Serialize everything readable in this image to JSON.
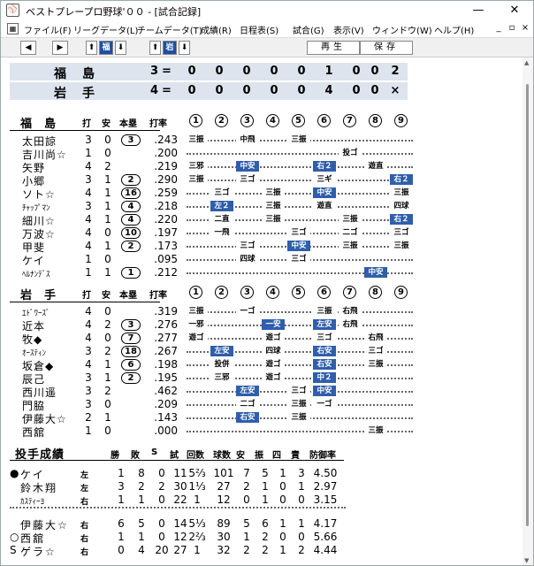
{
  "window": {
    "title": "ベストプレープロ野球'００ - [試合記録]",
    "minimize": "—",
    "maximize": "☐",
    "close": "✕"
  },
  "menu": [
    "ファイル(F)",
    "リーグデータ(L)",
    "チームデータ(T)",
    "成績(R)",
    "日程表(S)",
    "試合(G)",
    "表示(V)",
    "ウィンドウ(W)",
    "ヘルプ(H)"
  ],
  "mdi": [
    "_",
    "▫",
    "×"
  ],
  "toolbar": {
    "prev": "◀",
    "next": "▶",
    "up1": "⬆",
    "team1": "福",
    "down1": "⬇",
    "up2": "⬆",
    "team2": "岩",
    "down2": "⬇",
    "replay": "再生",
    "save": "保存"
  },
  "score": {
    "rows": [
      {
        "team": "福島",
        "total": "3",
        "eq": "=",
        "innings": [
          "0",
          "0",
          "0",
          "0",
          "0",
          "1",
          "0",
          "0",
          "2"
        ]
      },
      {
        "team": "岩手",
        "total": "4",
        "eq": "=",
        "innings": [
          "0",
          "0",
          "0",
          "0",
          "0",
          "4",
          "0",
          "0",
          "×"
        ]
      }
    ]
  },
  "labels": {
    "ab": "打",
    "hit": "安",
    "hr": "本塁",
    "avg": "打率",
    "innings": [
      "1",
      "2",
      "3",
      "4",
      "5",
      "6",
      "7",
      "8",
      "9"
    ]
  },
  "team1": {
    "name": "福島",
    "players": [
      {
        "name": "太田諒",
        "ab": "3",
        "h": "0",
        "hr": "3",
        "avg": ".243",
        "res": [
          [
            "1",
            "三振",
            0
          ],
          [
            "3",
            "中飛",
            0
          ],
          [
            "5",
            "三振",
            0
          ]
        ]
      },
      {
        "name": "吉川尚☆",
        "ab": "1",
        "h": "0",
        "hr": "",
        "avg": ".200",
        "res": [
          [
            "7",
            "投ゴ",
            0
          ]
        ]
      },
      {
        "name": "矢野",
        "ab": "4",
        "h": "2",
        "hr": "",
        "avg": ".219",
        "res": [
          [
            "1",
            "三邪",
            0
          ],
          [
            "3",
            "中安",
            1
          ],
          [
            "6",
            "右２",
            1
          ],
          [
            "8",
            "遊直",
            0
          ]
        ]
      },
      {
        "name": "小郷",
        "ab": "3",
        "h": "1",
        "hr": "2",
        "avg": ".290",
        "res": [
          [
            "1",
            "三振",
            0
          ],
          [
            "3",
            "三ゴ",
            0
          ],
          [
            "6",
            "三ギ",
            0
          ],
          [
            "9",
            "右２",
            1
          ]
        ]
      },
      {
        "name": "ソト☆",
        "ab": "4",
        "h": "1",
        "hr": "16",
        "avg": ".259",
        "res": [
          [
            "2",
            "三ゴ",
            0
          ],
          [
            "4",
            "三振",
            0
          ],
          [
            "6",
            "中安",
            1
          ],
          [
            "9",
            "三振",
            0
          ]
        ]
      },
      {
        "name": "ﾁｬｯﾌﾟﾏﾝ",
        "small": true,
        "ab": "3",
        "h": "1",
        "hr": "4",
        "avg": ".218",
        "res": [
          [
            "2",
            "左２",
            1
          ],
          [
            "4",
            "三振",
            0
          ],
          [
            "6",
            "遊直",
            0
          ],
          [
            "9",
            "四球",
            0
          ]
        ]
      },
      {
        "name": "細川☆",
        "ab": "4",
        "h": "1",
        "hr": "4",
        "avg": ".220",
        "res": [
          [
            "2",
            "二直",
            0
          ],
          [
            "4",
            "三振",
            0
          ],
          [
            "7",
            "三振",
            0
          ],
          [
            "9",
            "右２",
            1
          ]
        ]
      },
      {
        "name": "万波☆",
        "ab": "4",
        "h": "0",
        "hr": "10",
        "avg": ".197",
        "res": [
          [
            "2",
            "一飛",
            0
          ],
          [
            "5",
            "三ゴ",
            0
          ],
          [
            "7",
            "二ゴ",
            0
          ],
          [
            "9",
            "三ゴ",
            0
          ]
        ]
      },
      {
        "name": "甲斐",
        "ab": "4",
        "h": "1",
        "hr": "2",
        "avg": ".173",
        "res": [
          [
            "3",
            "三ゴ",
            0
          ],
          [
            "5",
            "中安",
            1
          ],
          [
            "7",
            "三振",
            0
          ],
          [
            "9",
            "三振",
            0
          ]
        ]
      },
      {
        "name": "ケイ",
        "ab": "1",
        "h": "0",
        "hr": "",
        "avg": ".095",
        "res": [
          [
            "3",
            "四球",
            0
          ],
          [
            "5",
            "三ゴ",
            0
          ]
        ]
      },
      {
        "name": "ﾍﾙﾅﾝﾃﾞｽ",
        "small": true,
        "ab": "1",
        "h": "1",
        "hr": "1",
        "avg": ".212",
        "res": [
          [
            "8",
            "中安",
            1
          ]
        ]
      }
    ]
  },
  "team2": {
    "name": "岩手",
    "players": [
      {
        "name": "ｴﾄﾞﾜｰｽﾞ",
        "small": true,
        "ab": "4",
        "h": "0",
        "hr": "",
        "avg": ".319",
        "res": [
          [
            "1",
            "三振",
            0
          ],
          [
            "3",
            "一ゴ",
            0
          ],
          [
            "6",
            "三振",
            0
          ],
          [
            "7",
            "右飛",
            0
          ]
        ]
      },
      {
        "name": "近本",
        "ab": "4",
        "h": "2",
        "hr": "3",
        "avg": ".276",
        "res": [
          [
            "1",
            "一邪",
            0
          ],
          [
            "4",
            "一安",
            1
          ],
          [
            "6",
            "左安",
            1
          ],
          [
            "7",
            "右飛",
            0
          ]
        ]
      },
      {
        "name": "牧◆",
        "ab": "4",
        "h": "0",
        "hr": "7",
        "avg": ".277",
        "res": [
          [
            "1",
            "遊ゴ",
            0
          ],
          [
            "4",
            "遊ゴ",
            0
          ],
          [
            "6",
            "三ゴ",
            0
          ],
          [
            "8",
            "右飛",
            0
          ]
        ]
      },
      {
        "name": "ｵｰｽﾃｨﾝ",
        "small": true,
        "ab": "3",
        "h": "2",
        "hr": "18",
        "avg": ".267",
        "res": [
          [
            "2",
            "左安",
            1
          ],
          [
            "4",
            "四球",
            0
          ],
          [
            "6",
            "右安",
            1
          ],
          [
            "8",
            "三ゴ",
            0
          ]
        ]
      },
      {
        "name": "坂倉◆",
        "ab": "4",
        "h": "1",
        "hr": "6",
        "avg": ".198",
        "res": [
          [
            "2",
            "投併",
            0
          ],
          [
            "4",
            "遊ゴ",
            0
          ],
          [
            "6",
            "右安",
            1
          ],
          [
            "8",
            "三振",
            0
          ]
        ]
      },
      {
        "name": "辰己",
        "ab": "3",
        "h": "1",
        "hr": "2",
        "avg": ".195",
        "res": [
          [
            "2",
            "三邪",
            0
          ],
          [
            "4",
            "遊ゴ",
            0
          ],
          [
            "6",
            "中２",
            1
          ]
        ]
      },
      {
        "name": "西川遥",
        "ab": "3",
        "h": "2",
        "hr": "",
        "avg": ".462",
        "res": [
          [
            "3",
            "左安",
            1
          ],
          [
            "5",
            "三ゴ",
            0
          ],
          [
            "6",
            "中安",
            1
          ]
        ]
      },
      {
        "name": "門脇",
        "ab": "3",
        "h": "0",
        "hr": "",
        "avg": ".209",
        "res": [
          [
            "3",
            "二ゴ",
            0
          ],
          [
            "5",
            "三振",
            0
          ],
          [
            "6",
            "一ゴ",
            0
          ]
        ]
      },
      {
        "name": "伊藤大☆",
        "ab": "2",
        "h": "1",
        "hr": "",
        "avg": ".143",
        "res": [
          [
            "3",
            "右安",
            1
          ],
          [
            "5",
            "三振",
            0
          ]
        ]
      },
      {
        "name": "西舘",
        "ab": "1",
        "h": "0",
        "hr": "",
        "avg": ".000",
        "res": [
          [
            "8",
            "三振",
            0
          ]
        ]
      }
    ]
  },
  "pitching": {
    "title": "投手成績",
    "headers": [
      "勝",
      "敗",
      "S",
      "試",
      "回数",
      "球数",
      "安",
      "振",
      "四",
      "責",
      "防御率"
    ],
    "rows": [
      {
        "mark": "●",
        "name": "ケイ",
        "hand": "左",
        "v": [
          "1",
          "8",
          "0",
          "11",
          "5⅔",
          "101",
          "7",
          "5",
          "1",
          "3",
          "4.50"
        ]
      },
      {
        "mark": "",
        "name": "鈴木翔",
        "hand": "左",
        "v": [
          "3",
          "2",
          "2",
          "30",
          "1⅓",
          "27",
          "2",
          "1",
          "0",
          "1",
          "2.97"
        ]
      },
      {
        "mark": "",
        "name": "ｶｽﾃｨｰﾖ",
        "small": true,
        "hand": "右",
        "v": [
          "1",
          "1",
          "0",
          "22",
          "1",
          "12",
          "0",
          "1",
          "0",
          "0",
          "3.15"
        ]
      },
      {
        "mark": "",
        "name": "伊藤大☆",
        "hand": "右",
        "v": [
          "6",
          "5",
          "0",
          "14",
          "5⅓",
          "89",
          "5",
          "6",
          "1",
          "1",
          "4.17"
        ]
      },
      {
        "mark": "○",
        "name": "西舘",
        "hand": "右",
        "v": [
          "1",
          "1",
          "0",
          "12",
          "2⅔",
          "30",
          "1",
          "2",
          "0",
          "0",
          "5.66"
        ]
      },
      {
        "mark": "S",
        "name": "ゲラ☆",
        "hand": "右",
        "v": [
          "0",
          "4",
          "20",
          "27",
          "1",
          "32",
          "2",
          "2",
          "1",
          "2",
          "4.44"
        ]
      }
    ]
  },
  "colors": {
    "hit": "#2f5eaa",
    "header_bg": "#dde4ee",
    "toolbar_sel": "#1c4fa0"
  }
}
